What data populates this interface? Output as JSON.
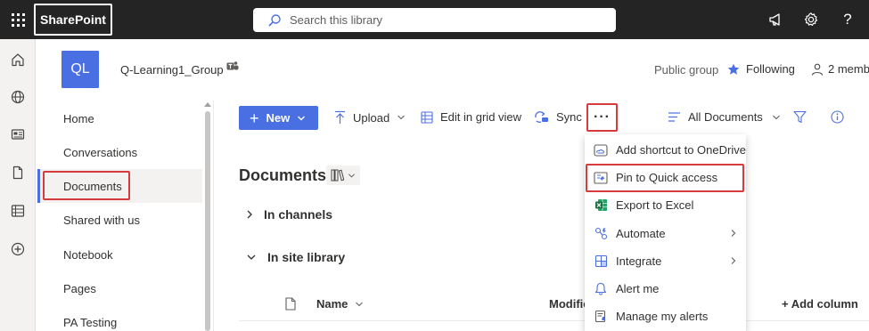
{
  "topbar": {
    "brand": "SharePoint",
    "search_placeholder": "Search this library",
    "background": "#242424"
  },
  "site": {
    "logo_initials": "QL",
    "logo_color": "#4a6fe3",
    "name": "Q-Learning1_Group",
    "privacy": "Public group",
    "follow_label": "Following",
    "members_label": "2 membe"
  },
  "nav": {
    "items": [
      {
        "label": "Home"
      },
      {
        "label": "Conversations"
      },
      {
        "label": "Documents",
        "selected": true
      },
      {
        "label": "Shared with us"
      },
      {
        "label": "Notebook"
      },
      {
        "label": "Pages"
      },
      {
        "label": "PA Testing"
      }
    ]
  },
  "commandbar": {
    "new_label": "New",
    "upload_label": "Upload",
    "edit_grid_label": "Edit in grid view",
    "sync_label": "Sync",
    "more_label": "···",
    "view_label": "All Documents"
  },
  "content": {
    "title": "Documents",
    "groups": [
      "In channels",
      "In site library"
    ],
    "columns": {
      "name": "Name",
      "modified": "Modifie",
      "add_column": "+ Add column"
    }
  },
  "menu": {
    "items": [
      {
        "label": "Add shortcut to OneDrive",
        "icon": "onedrive-shortcut-icon"
      },
      {
        "label": "Pin to Quick access",
        "icon": "pin-icon"
      },
      {
        "label": "Export to Excel",
        "icon": "excel-icon"
      },
      {
        "label": "Automate",
        "icon": "automate-icon",
        "submenu": true
      },
      {
        "label": "Integrate",
        "icon": "integrate-icon",
        "submenu": true
      },
      {
        "label": "Alert me",
        "icon": "alert-icon"
      },
      {
        "label": "Manage my alerts",
        "icon": "manage-alerts-icon"
      }
    ]
  },
  "colors": {
    "accent": "#4a6fe3",
    "highlight_box": "#d83b3b",
    "excel_green": "#1d6f42"
  }
}
